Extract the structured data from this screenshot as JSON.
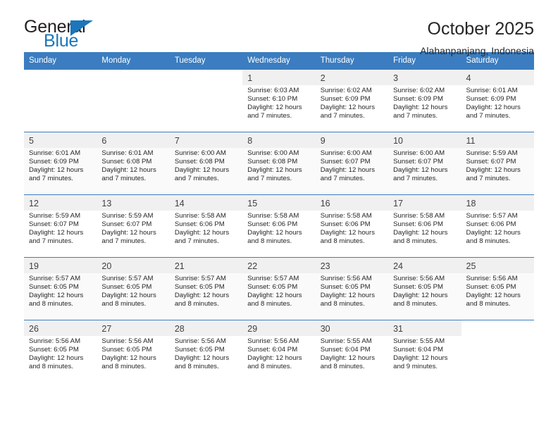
{
  "logo": {
    "word_general": "General",
    "word_blue": "Blue",
    "triangle": "blue-triangle-icon"
  },
  "header": {
    "title": "October 2025",
    "subtitle": "Alahanpanjang, Indonesia"
  },
  "colors": {
    "header_blue": "#3b7dc0",
    "logo_blue": "#1b76bc",
    "text": "#262626",
    "row_alt": "#fafafa",
    "daynum_strip": "#f0f0f0"
  },
  "weekdays": [
    "Sunday",
    "Monday",
    "Tuesday",
    "Wednesday",
    "Thursday",
    "Friday",
    "Saturday"
  ],
  "labels": {
    "sunrise_prefix": "Sunrise: ",
    "sunset_prefix": "Sunset: ",
    "daylight_prefix": "Daylight: "
  },
  "weeks": [
    [
      {
        "empty": true
      },
      {
        "empty": true
      },
      {
        "empty": true
      },
      {
        "day": "1",
        "sunrise": "Sunrise: 6:03 AM",
        "sunset": "Sunset: 6:10 PM",
        "daylight1": "Daylight: 12 hours",
        "daylight2": "and 7 minutes."
      },
      {
        "day": "2",
        "sunrise": "Sunrise: 6:02 AM",
        "sunset": "Sunset: 6:09 PM",
        "daylight1": "Daylight: 12 hours",
        "daylight2": "and 7 minutes."
      },
      {
        "day": "3",
        "sunrise": "Sunrise: 6:02 AM",
        "sunset": "Sunset: 6:09 PM",
        "daylight1": "Daylight: 12 hours",
        "daylight2": "and 7 minutes."
      },
      {
        "day": "4",
        "sunrise": "Sunrise: 6:01 AM",
        "sunset": "Sunset: 6:09 PM",
        "daylight1": "Daylight: 12 hours",
        "daylight2": "and 7 minutes."
      }
    ],
    [
      {
        "day": "5",
        "sunrise": "Sunrise: 6:01 AM",
        "sunset": "Sunset: 6:09 PM",
        "daylight1": "Daylight: 12 hours",
        "daylight2": "and 7 minutes."
      },
      {
        "day": "6",
        "sunrise": "Sunrise: 6:01 AM",
        "sunset": "Sunset: 6:08 PM",
        "daylight1": "Daylight: 12 hours",
        "daylight2": "and 7 minutes."
      },
      {
        "day": "7",
        "sunrise": "Sunrise: 6:00 AM",
        "sunset": "Sunset: 6:08 PM",
        "daylight1": "Daylight: 12 hours",
        "daylight2": "and 7 minutes."
      },
      {
        "day": "8",
        "sunrise": "Sunrise: 6:00 AM",
        "sunset": "Sunset: 6:08 PM",
        "daylight1": "Daylight: 12 hours",
        "daylight2": "and 7 minutes."
      },
      {
        "day": "9",
        "sunrise": "Sunrise: 6:00 AM",
        "sunset": "Sunset: 6:07 PM",
        "daylight1": "Daylight: 12 hours",
        "daylight2": "and 7 minutes."
      },
      {
        "day": "10",
        "sunrise": "Sunrise: 6:00 AM",
        "sunset": "Sunset: 6:07 PM",
        "daylight1": "Daylight: 12 hours",
        "daylight2": "and 7 minutes."
      },
      {
        "day": "11",
        "sunrise": "Sunrise: 5:59 AM",
        "sunset": "Sunset: 6:07 PM",
        "daylight1": "Daylight: 12 hours",
        "daylight2": "and 7 minutes."
      }
    ],
    [
      {
        "day": "12",
        "sunrise": "Sunrise: 5:59 AM",
        "sunset": "Sunset: 6:07 PM",
        "daylight1": "Daylight: 12 hours",
        "daylight2": "and 7 minutes."
      },
      {
        "day": "13",
        "sunrise": "Sunrise: 5:59 AM",
        "sunset": "Sunset: 6:07 PM",
        "daylight1": "Daylight: 12 hours",
        "daylight2": "and 7 minutes."
      },
      {
        "day": "14",
        "sunrise": "Sunrise: 5:58 AM",
        "sunset": "Sunset: 6:06 PM",
        "daylight1": "Daylight: 12 hours",
        "daylight2": "and 7 minutes."
      },
      {
        "day": "15",
        "sunrise": "Sunrise: 5:58 AM",
        "sunset": "Sunset: 6:06 PM",
        "daylight1": "Daylight: 12 hours",
        "daylight2": "and 8 minutes."
      },
      {
        "day": "16",
        "sunrise": "Sunrise: 5:58 AM",
        "sunset": "Sunset: 6:06 PM",
        "daylight1": "Daylight: 12 hours",
        "daylight2": "and 8 minutes."
      },
      {
        "day": "17",
        "sunrise": "Sunrise: 5:58 AM",
        "sunset": "Sunset: 6:06 PM",
        "daylight1": "Daylight: 12 hours",
        "daylight2": "and 8 minutes."
      },
      {
        "day": "18",
        "sunrise": "Sunrise: 5:57 AM",
        "sunset": "Sunset: 6:06 PM",
        "daylight1": "Daylight: 12 hours",
        "daylight2": "and 8 minutes."
      }
    ],
    [
      {
        "day": "19",
        "sunrise": "Sunrise: 5:57 AM",
        "sunset": "Sunset: 6:05 PM",
        "daylight1": "Daylight: 12 hours",
        "daylight2": "and 8 minutes."
      },
      {
        "day": "20",
        "sunrise": "Sunrise: 5:57 AM",
        "sunset": "Sunset: 6:05 PM",
        "daylight1": "Daylight: 12 hours",
        "daylight2": "and 8 minutes."
      },
      {
        "day": "21",
        "sunrise": "Sunrise: 5:57 AM",
        "sunset": "Sunset: 6:05 PM",
        "daylight1": "Daylight: 12 hours",
        "daylight2": "and 8 minutes."
      },
      {
        "day": "22",
        "sunrise": "Sunrise: 5:57 AM",
        "sunset": "Sunset: 6:05 PM",
        "daylight1": "Daylight: 12 hours",
        "daylight2": "and 8 minutes."
      },
      {
        "day": "23",
        "sunrise": "Sunrise: 5:56 AM",
        "sunset": "Sunset: 6:05 PM",
        "daylight1": "Daylight: 12 hours",
        "daylight2": "and 8 minutes."
      },
      {
        "day": "24",
        "sunrise": "Sunrise: 5:56 AM",
        "sunset": "Sunset: 6:05 PM",
        "daylight1": "Daylight: 12 hours",
        "daylight2": "and 8 minutes."
      },
      {
        "day": "25",
        "sunrise": "Sunrise: 5:56 AM",
        "sunset": "Sunset: 6:05 PM",
        "daylight1": "Daylight: 12 hours",
        "daylight2": "and 8 minutes."
      }
    ],
    [
      {
        "day": "26",
        "sunrise": "Sunrise: 5:56 AM",
        "sunset": "Sunset: 6:05 PM",
        "daylight1": "Daylight: 12 hours",
        "daylight2": "and 8 minutes."
      },
      {
        "day": "27",
        "sunrise": "Sunrise: 5:56 AM",
        "sunset": "Sunset: 6:05 PM",
        "daylight1": "Daylight: 12 hours",
        "daylight2": "and 8 minutes."
      },
      {
        "day": "28",
        "sunrise": "Sunrise: 5:56 AM",
        "sunset": "Sunset: 6:05 PM",
        "daylight1": "Daylight: 12 hours",
        "daylight2": "and 8 minutes."
      },
      {
        "day": "29",
        "sunrise": "Sunrise: 5:56 AM",
        "sunset": "Sunset: 6:04 PM",
        "daylight1": "Daylight: 12 hours",
        "daylight2": "and 8 minutes."
      },
      {
        "day": "30",
        "sunrise": "Sunrise: 5:55 AM",
        "sunset": "Sunset: 6:04 PM",
        "daylight1": "Daylight: 12 hours",
        "daylight2": "and 8 minutes."
      },
      {
        "day": "31",
        "sunrise": "Sunrise: 5:55 AM",
        "sunset": "Sunset: 6:04 PM",
        "daylight1": "Daylight: 12 hours",
        "daylight2": "and 9 minutes."
      },
      {
        "empty": true
      }
    ]
  ]
}
